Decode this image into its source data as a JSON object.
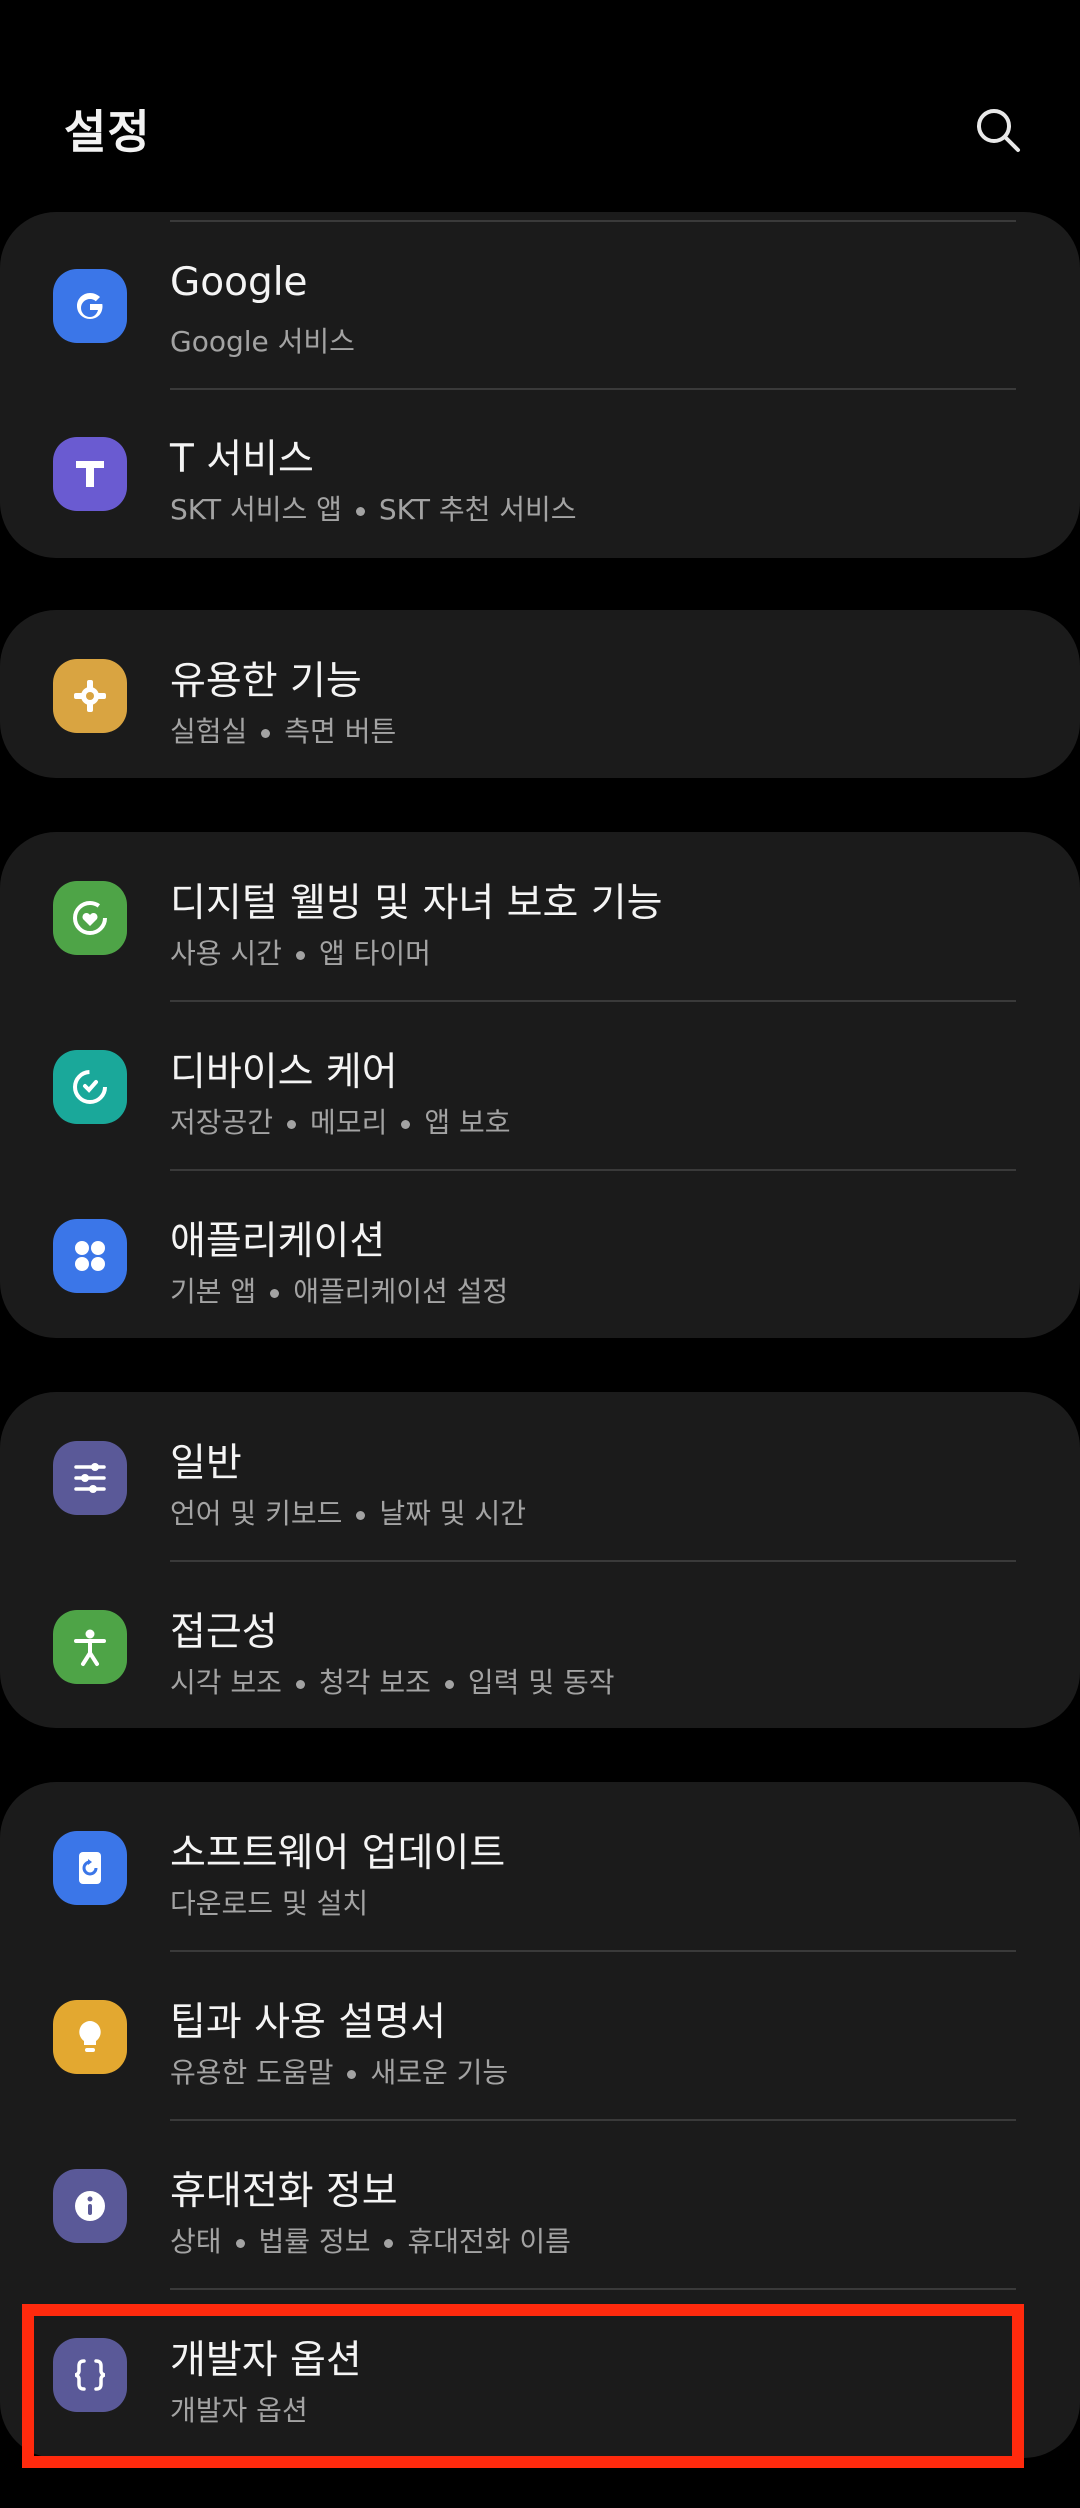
{
  "header": {
    "title": "설정",
    "search_icon": "search-icon"
  },
  "colors": {
    "google": "#3b76e8",
    "tservice": "#6a5bd1",
    "advanced": "#d9a441",
    "wellbeing": "#4ea447",
    "devicecare": "#1aa89a",
    "apps": "#3b76e8",
    "general": "#5a5998",
    "accessibility": "#4ea447",
    "update": "#3b76e8",
    "tips": "#e3a830",
    "about": "#5a5998",
    "developer": "#5a5998",
    "highlight": "#ff2a0d"
  },
  "groups": [
    {
      "items": [
        {
          "title": "Google",
          "subs": [
            "Google 서비스"
          ],
          "icon": "google-icon"
        },
        {
          "title": "T 서비스",
          "subs": [
            "SKT 서비스 앱",
            "SKT 추천 서비스"
          ],
          "icon": "t-service-icon"
        }
      ]
    },
    {
      "items": [
        {
          "title": "유용한 기능",
          "subs": [
            "실험실",
            "측면 버튼"
          ],
          "icon": "puzzle-gear-icon"
        }
      ]
    },
    {
      "items": [
        {
          "title": "디지털 웰빙 및 자녀 보호 기능",
          "subs": [
            "사용 시간",
            "앱 타이머"
          ],
          "icon": "wellbeing-heart-icon"
        },
        {
          "title": "디바이스 케어",
          "subs": [
            "저장공간",
            "메모리",
            "앱 보호"
          ],
          "icon": "device-care-icon"
        },
        {
          "title": "애플리케이션",
          "subs": [
            "기본 앱",
            "애플리케이션 설정"
          ],
          "icon": "apps-grid-icon"
        }
      ]
    },
    {
      "items": [
        {
          "title": "일반",
          "subs": [
            "언어 및 키보드",
            "날짜 및 시간"
          ],
          "icon": "sliders-icon"
        },
        {
          "title": "접근성",
          "subs": [
            "시각 보조",
            "청각 보조",
            "입력 및 동작"
          ],
          "icon": "accessibility-person-icon"
        }
      ]
    },
    {
      "items": [
        {
          "title": "소프트웨어 업데이트",
          "subs": [
            "다운로드 및 설치"
          ],
          "icon": "software-update-icon"
        },
        {
          "title": "팁과 사용 설명서",
          "subs": [
            "유용한 도움말",
            "새로운 기능"
          ],
          "icon": "lightbulb-icon"
        },
        {
          "title": "휴대전화 정보",
          "subs": [
            "상태",
            "법률 정보",
            "휴대전화 이름"
          ],
          "icon": "info-icon"
        },
        {
          "title": "개발자 옵션",
          "subs": [
            "개발자 옵션"
          ],
          "icon": "developer-braces-icon"
        }
      ]
    }
  ]
}
